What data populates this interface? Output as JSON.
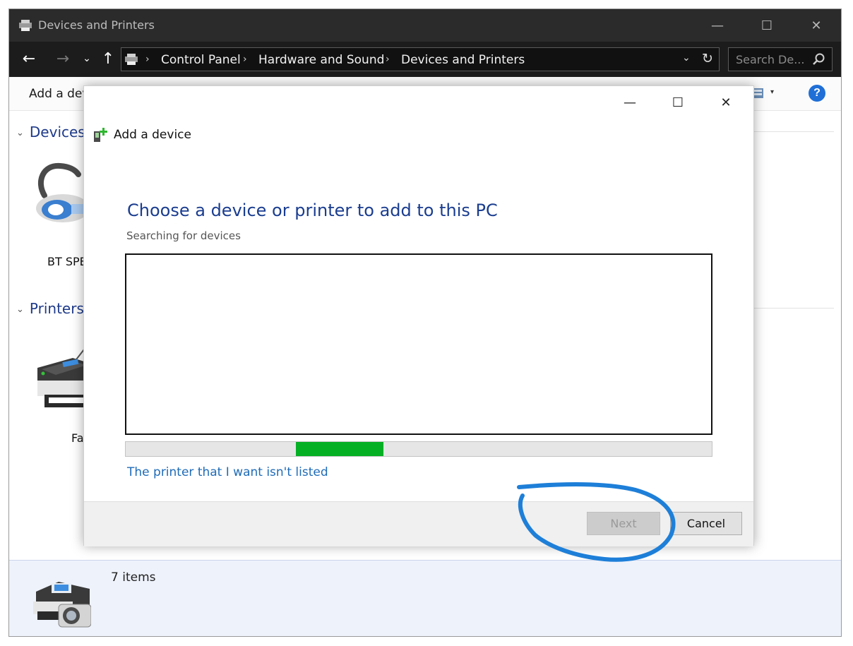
{
  "window": {
    "title": "Devices and Printers",
    "min_glyph": "—",
    "max_glyph": "☐",
    "close_glyph": "✕"
  },
  "nav": {
    "back": "←",
    "forward": "→",
    "recent": "⌄",
    "up": "↑",
    "breadcrumbs": [
      "Control Panel",
      "Hardware and Sound",
      "Devices and Printers"
    ],
    "separator": "›",
    "dropdown": "⌄",
    "refresh": "↻",
    "search_placeholder": "Search De..."
  },
  "toolbar": {
    "add_device": "Add a device",
    "view_dropdown": "▾",
    "help": "?"
  },
  "groups": {
    "devices": "Devices",
    "printers": "Printers",
    "chevron": "⌄"
  },
  "items": {
    "device_label": "BT SPE",
    "printer_label": "Fa"
  },
  "status": {
    "count": "7 items"
  },
  "dialog": {
    "title": "Add a device",
    "heading": "Choose a device or printer to add to this PC",
    "status": "Searching for devices",
    "progress_start": 0.29,
    "progress_end": 0.44,
    "progress_color": "#06b025",
    "link": "The printer that I want isn't listed",
    "next": "Next",
    "cancel": "Cancel",
    "min_glyph": "—",
    "max_glyph": "☐",
    "close_glyph": "✕"
  },
  "annotation_color": "#1e7fd8"
}
